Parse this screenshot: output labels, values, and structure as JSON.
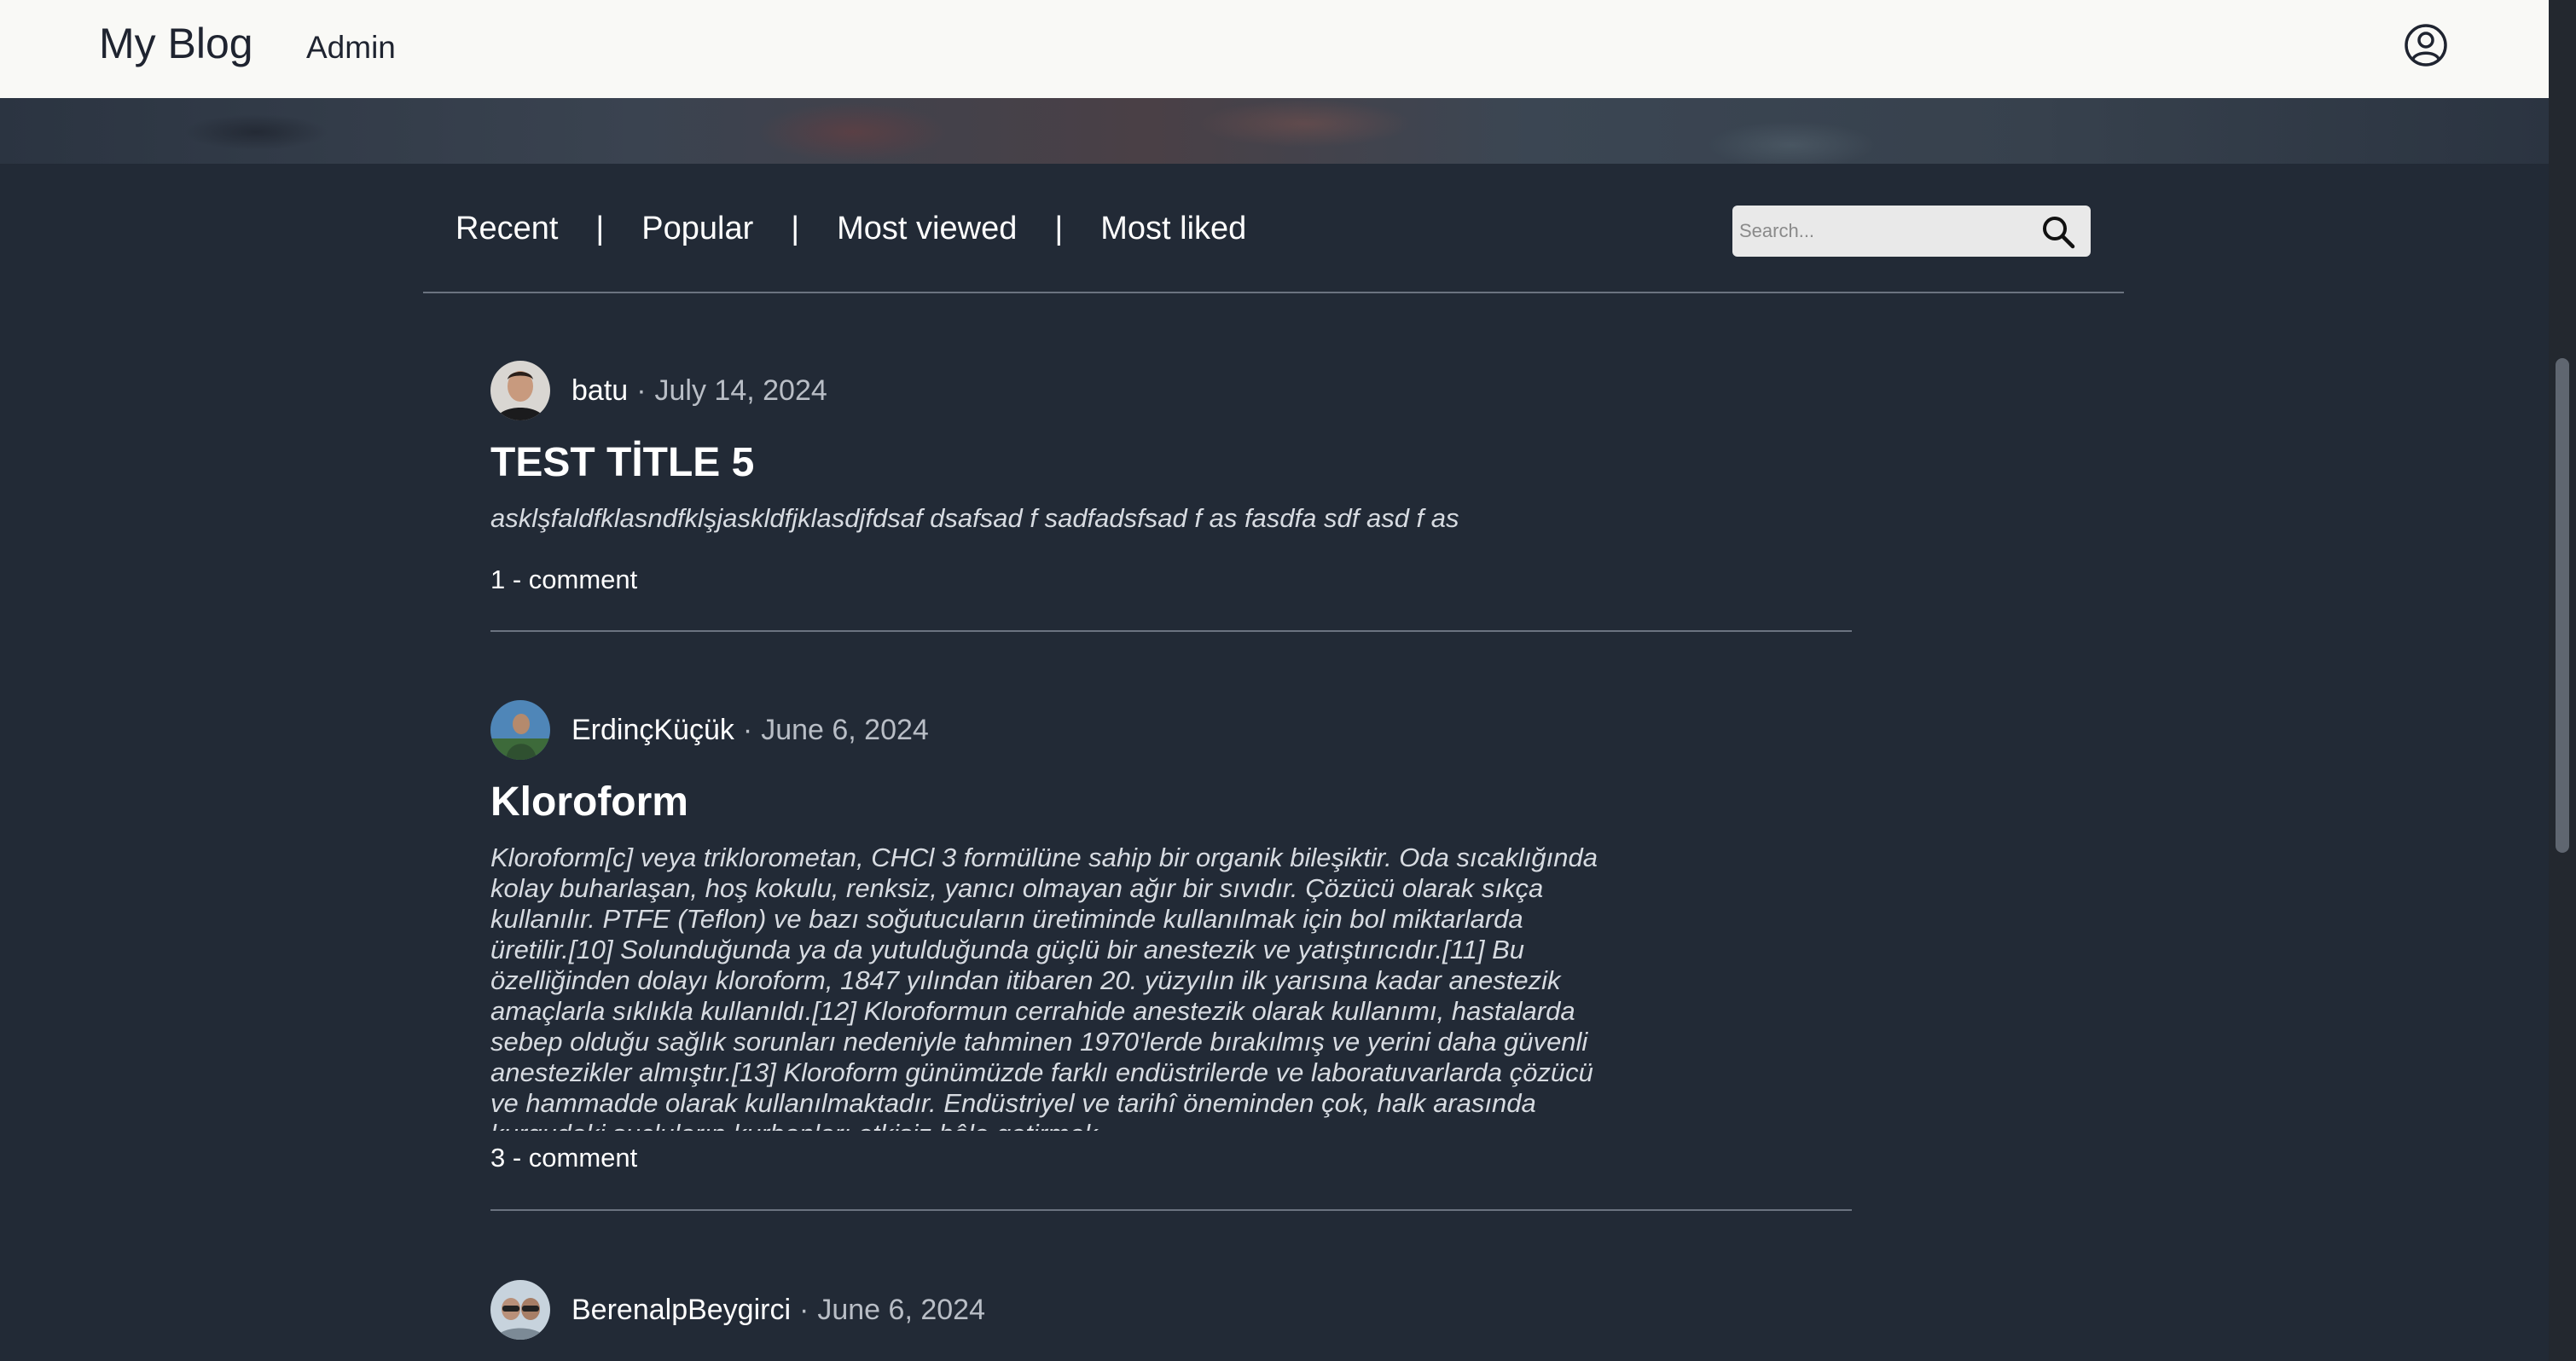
{
  "navbar": {
    "brand": "My Blog",
    "admin_link": "Admin",
    "user_icon": "user-circle-icon"
  },
  "tabs": [
    {
      "label": "Recent"
    },
    {
      "label": "Popular"
    },
    {
      "label": "Most viewed"
    },
    {
      "label": "Most liked"
    }
  ],
  "tab_separator": "|",
  "search": {
    "placeholder": "Search...",
    "value": "",
    "icon": "magnifier-icon"
  },
  "posts": [
    {
      "author": "batu",
      "date": "July 14, 2024",
      "title": "TEST TİTLE 5",
      "excerpt": "asklşfaldfklasndfklşjaskldfjklasdjfdsaf dsafsad f sadfadsfsad f as fasdfa sdf asd f as",
      "comments": "1 - comment"
    },
    {
      "author": "ErdinçKüçük",
      "date": "June 6, 2024",
      "title": "Kloroform",
      "excerpt": "Kloroform[c] veya triklorometan, CHCl 3 formülüne sahip bir organik bileşiktir. Oda sıcaklığında kolay buharlaşan, hoş kokulu, renksiz, yanıcı olmayan ağır bir sıvıdır. Çözücü olarak sıkça kullanılır. PTFE (Teflon) ve bazı soğutucuların üretiminde kullanılmak için bol miktarlarda üretilir.[10] Solunduğunda ya da yutulduğunda güçlü bir anestezik ve yatıştırıcıdır.[11] Bu özelliğinden dolayı kloroform, 1847 yılından itibaren 20. yüzyılın ilk yarısına kadar anestezik amaçlarla sıklıkla kullanıldı.[12] Kloroformun cerrahide anestezik olarak kullanımı, hastalarda sebep olduğu sağlık sorunları nedeniyle tahminen 1970'lerde bırakılmış ve yerini daha güvenli anestezikler almıştır.[13] Kloroform günümüzde farklı endüstrilerde ve laboratuvarlarda çözücü ve hammadde olarak kullanılmaktadır. Endüstriyel ve tarihî öneminden çok, halk arasında kurgudaki suçluların kurbanları etkisiz hâle getirmek",
      "comments": "3 - comment"
    },
    {
      "author": "BerenalpBeygirci",
      "date": "June 6, 2024",
      "title": "",
      "excerpt": "",
      "comments": ""
    }
  ]
}
